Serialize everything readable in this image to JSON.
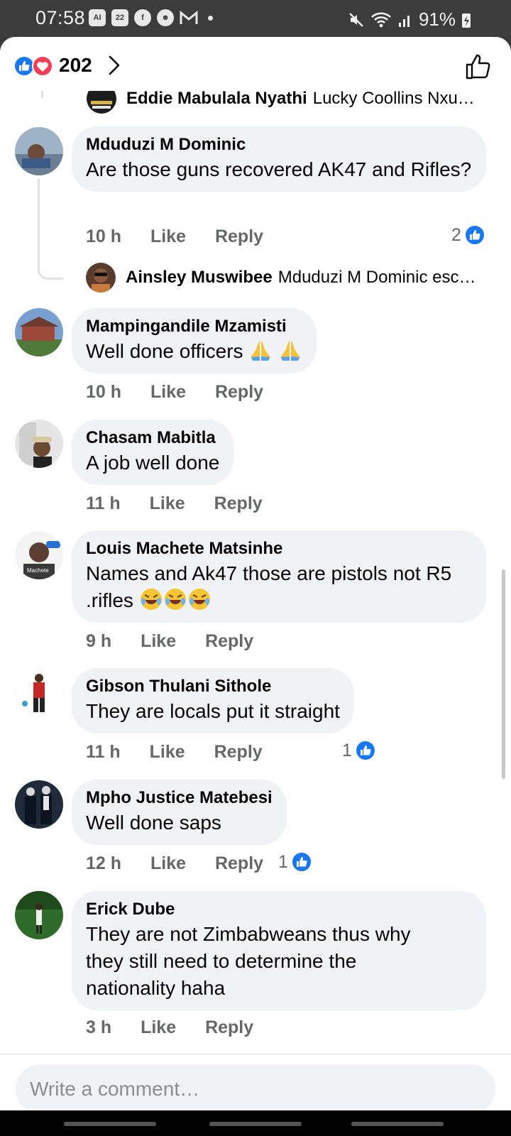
{
  "status_bar": {
    "time": "07:58",
    "battery": "91%",
    "icons_left": [
      "ai-badge-icon",
      "calendar-22-icon",
      "facebook-icon",
      "snapchat-icon",
      "gmail-icon"
    ],
    "calendar_day": "22",
    "ai_label": "AI"
  },
  "header": {
    "reaction_count": "202",
    "reactions": [
      "like",
      "love"
    ]
  },
  "colors": {
    "like_blue": "#1877f2",
    "love_red": "#f33e58",
    "bubble_bg": "#f0f2f5",
    "meta_gray": "#65676b"
  },
  "partial_top_reply": {
    "name": "Eddie Mabulala Nyathi",
    "text": "Lucky Coollins Nxu…"
  },
  "comments": [
    {
      "author": "Mduduzi M Dominic",
      "text": "Are those guns recovered AK47 and Rifles?",
      "time": "10 h",
      "like": "Like",
      "reply": "Reply",
      "likes": "2"
    },
    {
      "author": "Mampingandile Mzamisti",
      "text": "Well done officers",
      "time": "10 h",
      "like": "Like",
      "reply": "Reply"
    },
    {
      "author": "Chasam Mabitla",
      "text": "A job well done",
      "time": "11 h",
      "like": "Like",
      "reply": "Reply"
    },
    {
      "author": "Louis Machete Matsinhe",
      "text": "Names and Ak47 those are  pistols not R5 .rifles",
      "time": "9 h",
      "like": "Like",
      "reply": "Reply",
      "avatar_label": "Machete"
    },
    {
      "author": "Gibson Thulani Sithole",
      "text": "They are locals put it straight",
      "time": "11 h",
      "like": "Like",
      "reply": "Reply",
      "likes": "1"
    },
    {
      "author": "Mpho Justice Matebesi",
      "text": "Well done saps",
      "time": "12 h",
      "like": "Like",
      "reply": "Reply",
      "likes": "1"
    },
    {
      "author": "Erick Dube",
      "text": "They are not Zimbabweans thus why they still need to determine the nationality haha",
      "time": "3 h",
      "like": "Like",
      "reply": "Reply"
    }
  ],
  "nested_reply": {
    "name": "Ainsley Muswibee",
    "text": "Mduduzi M Dominic esc…"
  },
  "composer": {
    "placeholder": "Write a comment…"
  }
}
